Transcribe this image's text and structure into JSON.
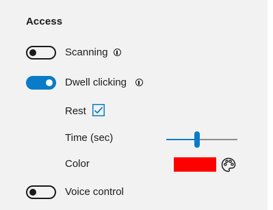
{
  "section": {
    "title": "Access"
  },
  "scanning": {
    "label": "Scanning",
    "enabled": false,
    "info_icon": "info-icon"
  },
  "dwell": {
    "label": "Dwell clicking",
    "enabled": true,
    "info_icon": "info-icon"
  },
  "rest": {
    "label": "Rest",
    "checked": true
  },
  "time": {
    "label": "Time (sec)",
    "slider_value_fraction": 0.43
  },
  "color": {
    "label": "Color",
    "value": "#ff0000",
    "picker_icon": "palette-icon"
  },
  "voice": {
    "label": "Voice control",
    "enabled": false
  },
  "theme": {
    "accent": "#0a7bc8",
    "panel_bg": "#f2f2f2"
  }
}
